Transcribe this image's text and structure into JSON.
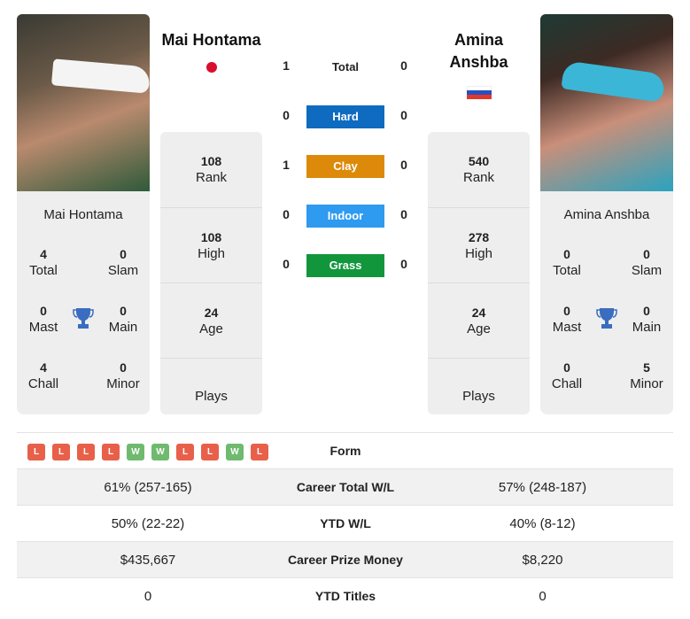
{
  "player1": {
    "name": "Mai Hontama",
    "flag": "japan-flag",
    "titles": {
      "total": "4",
      "slam": "0",
      "mast": "0",
      "main": "0",
      "chall": "4",
      "minor": "0"
    },
    "rank": "108",
    "high": "108",
    "age": "24",
    "plays": ""
  },
  "player2": {
    "name_line1": "Amina",
    "name_line2": "Anshba",
    "name": "Amina Anshba",
    "flag": "russia-flag",
    "titles": {
      "total": "0",
      "slam": "0",
      "mast": "0",
      "main": "0",
      "chall": "0",
      "minor": "5"
    },
    "rank": "540",
    "high": "278",
    "age": "24",
    "plays": ""
  },
  "labels": {
    "total": "Total",
    "slam": "Slam",
    "mast": "Mast",
    "main": "Main",
    "chall": "Chall",
    "minor": "Minor",
    "rank": "Rank",
    "high": "High",
    "age": "Age",
    "plays": "Plays"
  },
  "h2h": {
    "total": {
      "label": "Total",
      "p1": "1",
      "p2": "0"
    },
    "surfaces": [
      {
        "label": "Hard",
        "p1": "0",
        "p2": "0",
        "color": "#0e6bc0"
      },
      {
        "label": "Clay",
        "p1": "1",
        "p2": "0",
        "color": "#dd8a0a"
      },
      {
        "label": "Indoor",
        "p1": "0",
        "p2": "0",
        "color": "#2e9af0"
      },
      {
        "label": "Grass",
        "p1": "0",
        "p2": "0",
        "color": "#12963c"
      }
    ]
  },
  "form": {
    "label": "Form",
    "results": [
      "L",
      "L",
      "L",
      "L",
      "W",
      "W",
      "L",
      "L",
      "W",
      "L"
    ],
    "colors": {
      "L": "#e8604a",
      "W": "#6fba6f"
    }
  },
  "comparison": [
    {
      "label": "Career Total W/L",
      "p1": "61% (257-165)",
      "p2": "57% (248-187)"
    },
    {
      "label": "YTD W/L",
      "p1": "50% (22-22)",
      "p2": "40% (8-12)"
    },
    {
      "label": "Career Prize Money",
      "p1": "$435,667",
      "p2": "$8,220"
    },
    {
      "label": "YTD Titles",
      "p1": "0",
      "p2": "0"
    }
  ]
}
